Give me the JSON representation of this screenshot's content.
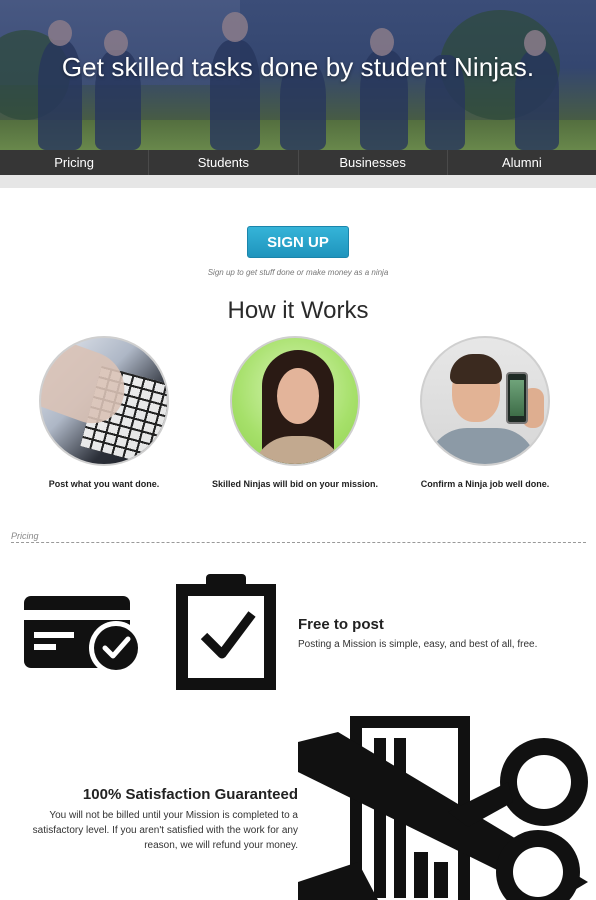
{
  "hero": {
    "title": "Get skilled tasks done by student Ninjas."
  },
  "nav": [
    {
      "label": "Pricing"
    },
    {
      "label": "Students"
    },
    {
      "label": "Businesses"
    },
    {
      "label": "Alumni"
    }
  ],
  "signup": {
    "button_label": "SIGN UP",
    "note": "Sign up to get stuff done or make money as a ninja"
  },
  "how_it_works": {
    "title": "How it Works",
    "steps": [
      {
        "caption": "Post what you want done.",
        "image": "typing-hands-keyboard"
      },
      {
        "caption": "Skilled Ninjas will bid on your mission.",
        "image": "smiling-woman"
      },
      {
        "caption": "Confirm a Ninja job well done.",
        "image": "man-holding-phone"
      }
    ]
  },
  "pricing": {
    "section_label": "Pricing",
    "features": [
      {
        "title": "Free to post",
        "description": "Posting a Mission is simple, easy, and best of all, free.",
        "icons": [
          "credit-card-check-icon",
          "clipboard-check-icon"
        ]
      },
      {
        "title": "100% Satisfaction Guaranteed",
        "description": "You will not be billed until your Mission is completed to a satisfactory level. If you aren't satisfied with the work for any reason, we will refund your money.",
        "icons": [
          "scissors-cutting-card-icon"
        ]
      }
    ]
  },
  "colors": {
    "nav_bg": "#363636",
    "signup_button": "#2aa4cc",
    "divider": "#999999"
  }
}
